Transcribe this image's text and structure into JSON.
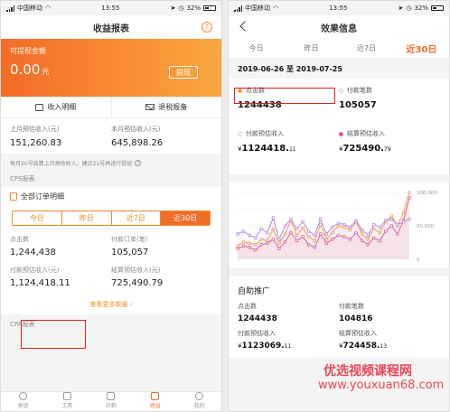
{
  "left": {
    "status": {
      "carrier": "中国移动",
      "time": "13:55",
      "battery": "32%"
    },
    "title": "收益报表",
    "help_icon": "?",
    "banner": {
      "label": "可提现金额",
      "amount": "0.00",
      "unit": "元",
      "withdraw": "提现"
    },
    "links": {
      "income": "收入明细",
      "tax": "退税报备"
    },
    "estimates": {
      "last_label": "上月预估收入(元)",
      "last_value": "151,260.83",
      "this_label": "本月预估收入(元)",
      "this_value": "645,898.26"
    },
    "note": "每月20号结算上月预估收入，建议21号再进行提现",
    "cps_label": "CPS报表",
    "orders_title": "全部订单明细",
    "segments": [
      "今日",
      "昨日",
      "近7日",
      "近30日"
    ],
    "stats": [
      {
        "label": "点击数",
        "value": "1,244,438"
      },
      {
        "label": "付款订单(笔)",
        "value": "105,057"
      },
      {
        "label": "付款预估收入(元)",
        "value": "1,124,418.11"
      },
      {
        "label": "结算预估收入(元)",
        "value": "725,490.79"
      }
    ],
    "more": "查看更多数据",
    "cpa_label": "CPA报表",
    "tabs": [
      "发现",
      "工具",
      "社群",
      "收益",
      "我的"
    ],
    "colors": {
      "accent": "#f06e2a",
      "highlight_box": "#d9231a"
    }
  },
  "right": {
    "status": {
      "carrier": "中国移动",
      "time": "13:55",
      "battery": "32%"
    },
    "title": "效果信息",
    "tabs": [
      "今日",
      "昨日",
      "近7日",
      "近30日"
    ],
    "range": "2019-06-26 至 2019-07-25",
    "metrics": [
      {
        "label": "点击数",
        "value": "1244438",
        "dot": "#f3a04a"
      },
      {
        "label": "付款笔数",
        "value": "105057",
        "dot": ""
      },
      {
        "label": "付款预估收入",
        "currency": "¥",
        "value": "1124418.",
        "dec": "11",
        "dot": ""
      },
      {
        "label": "结算预估收入",
        "currency": "¥",
        "value": "725490.",
        "dec": "79",
        "dot": "#e05aa0"
      }
    ],
    "chart_y_ticks": [
      "100,000",
      "50,000",
      "0"
    ],
    "self_title": "自助推广",
    "self": [
      {
        "label": "点击数",
        "value": "1244438"
      },
      {
        "label": "付款笔数",
        "value": "104816"
      },
      {
        "label": "付款预估收入",
        "currency": "¥",
        "value": "1123069.",
        "dec": "11"
      },
      {
        "label": "结算预估收入",
        "currency": "¥",
        "value": "724458.",
        "dec": "13"
      }
    ]
  },
  "watermark": {
    "line1": "优选视频课程网",
    "line2": "www.youxuan68.com"
  },
  "chart_data": {
    "type": "line",
    "x": [
      1,
      2,
      3,
      4,
      5,
      6,
      7,
      8,
      9,
      10,
      11,
      12,
      13,
      14,
      15,
      16,
      17,
      18,
      19,
      20,
      21,
      22,
      23,
      24,
      25,
      26,
      27,
      28,
      29,
      30
    ],
    "series": [
      {
        "values": [
          20000,
          26000,
          24000,
          22000,
          30000,
          28000,
          45000,
          24000,
          38000,
          58000,
          36000,
          47000,
          34000,
          28000,
          52000,
          30000,
          40000,
          50000,
          48000,
          44000,
          56000,
          38000,
          30000,
          46000,
          40000,
          56000,
          65000,
          50000,
          70000,
          100000
        ]
      },
      {
        "values": [
          16000,
          20000,
          18000,
          14000,
          22000,
          24000,
          30000,
          16000,
          26000,
          40000,
          28000,
          34000,
          22000,
          18000,
          38000,
          24000,
          30000,
          36000,
          34000,
          30000,
          40000,
          28000,
          22000,
          32000,
          28000,
          42000,
          50000,
          38000,
          58000,
          92000
        ]
      },
      {
        "values": [
          38000,
          42000,
          36000,
          32000,
          46000,
          40000,
          62000,
          30000,
          50000,
          60000,
          46000,
          56000,
          42000,
          36000,
          60000,
          38000,
          48000,
          54000,
          52000,
          48000,
          58000,
          44000,
          36000,
          52000,
          48000,
          58000,
          60000,
          52000,
          56000,
          60000
        ]
      }
    ],
    "ylim": [
      0,
      100000
    ],
    "colors": [
      "#f3a04a",
      "#e05aa0",
      "#b488e0"
    ]
  }
}
